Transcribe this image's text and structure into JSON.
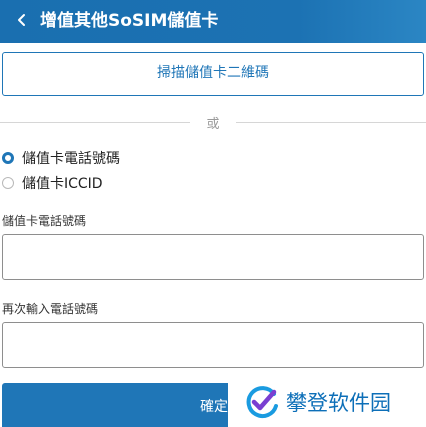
{
  "header": {
    "title": "增值其他SoSIM儲值卡",
    "back_icon": "chevron-left-icon"
  },
  "scan_button": {
    "label": "掃描儲值卡二維碼"
  },
  "divider": {
    "text": "或"
  },
  "options": [
    {
      "label": "儲值卡電話號碼",
      "selected": true
    },
    {
      "label": "儲值卡ICCID",
      "selected": false
    }
  ],
  "fields": {
    "phone_label": "儲值卡電話號碼",
    "phone_value": "",
    "confirm_label": "再次輸入電話號碼",
    "confirm_value": ""
  },
  "confirm_button": {
    "label": "確定"
  },
  "watermark": {
    "text": "攀登软件园",
    "icon": "check-logo-icon"
  },
  "colors": {
    "primary": "#1f76b7",
    "header": "#1a6fb0"
  }
}
